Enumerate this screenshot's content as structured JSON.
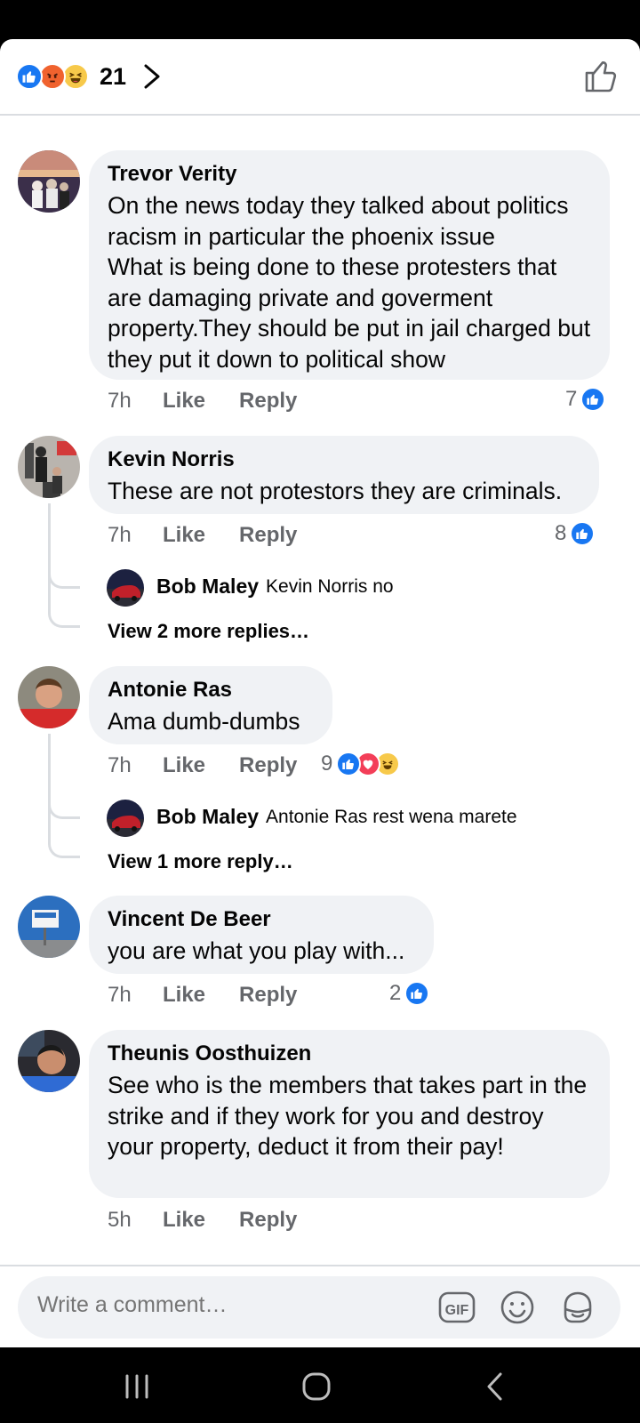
{
  "header": {
    "reaction_count": "21",
    "reactions": [
      "like",
      "angry",
      "haha"
    ]
  },
  "comments": [
    {
      "author": "Trevor Verity",
      "text": "On the news today they talked about politics racism in particular the phoenix issue\nWhat is being done to these protesters  that are damaging private  and goverment property.They should be put in jail charged but they put it down to political show",
      "time": "7h",
      "like_label": "Like",
      "reply_label": "Reply",
      "likes": "7"
    },
    {
      "author": "Kevin Norris",
      "text": "These are not protestors they are criminals.",
      "time": "7h",
      "like_label": "Like",
      "reply_label": "Reply",
      "likes": "8",
      "reply_preview": {
        "author": "Bob Maley",
        "text": "Kevin Norris no"
      },
      "more_replies": "View 2 more replies…"
    },
    {
      "author": "Antonie Ras",
      "text": "Ama dumb-dumbs",
      "time": "7h",
      "like_label": "Like",
      "reply_label": "Reply",
      "likes": "9",
      "reply_preview": {
        "author": "Bob Maley",
        "text": "Antonie Ras rest wena marete"
      },
      "more_replies": "View 1 more reply…"
    },
    {
      "author": "Vincent De Beer",
      "text": "you are what you play with...",
      "time": "7h",
      "like_label": "Like",
      "reply_label": "Reply",
      "likes": "2"
    },
    {
      "author": "Theunis Oosthuizen",
      "text": "See who is the members that takes part in the strike and if they work for you and destroy your property, deduct it from their pay!",
      "time": "5h",
      "like_label": "Like",
      "reply_label": "Reply"
    }
  ],
  "composer": {
    "placeholder": "Write a comment…",
    "gif_label": "GIF"
  },
  "colors": {
    "accent": "#1877f2",
    "bubble": "#f0f2f5",
    "muted_text": "#65676b"
  }
}
